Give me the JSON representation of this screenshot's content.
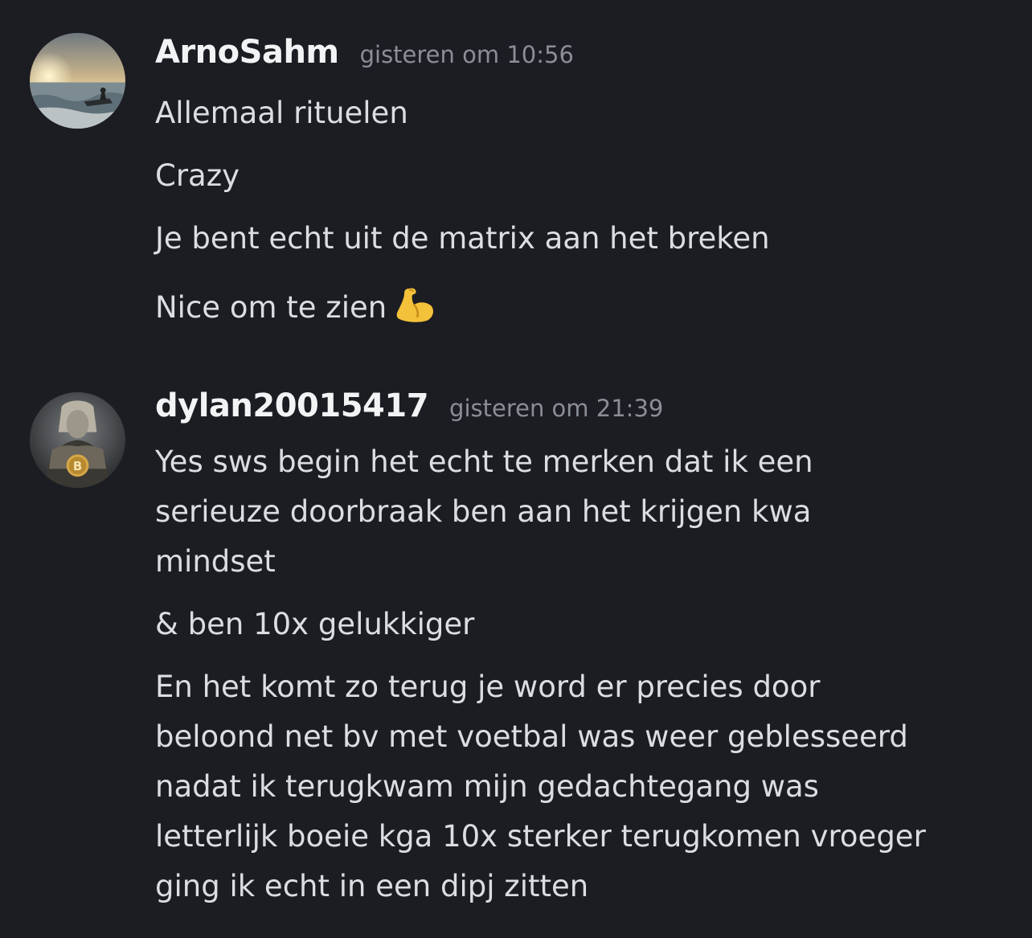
{
  "messages": [
    {
      "username": "ArnoSahm",
      "timestamp": "gisteren om 10:56",
      "avatar_icon": "seascape-jetski-avatar",
      "lines": [
        "Allemaal rituelen",
        "Crazy",
        "Je bent echt uit de matrix aan het breken",
        "Nice om te zien"
      ],
      "emoji": "flexed-biceps-icon"
    },
    {
      "username": "dylan20015417",
      "timestamp": "gisteren om 21:39",
      "avatar_icon": "armored-figure-bitcoin-avatar",
      "paragraphs": [
        [
          "Yes sws begin het echt te merken dat ik een",
          "serieuze doorbraak ben aan het krijgen kwa",
          "mindset"
        ],
        [
          "& ben 10x gelukkiger"
        ],
        [
          "En het komt zo terug je word er precies door",
          "beloond net bv met voetbal was weer geblesseerd",
          "nadat ik terugkwam mijn gedachtegang was",
          "letterlijk boeie kga 10x sterker terugkomen vroeger",
          "ging ik echt in een dipj zitten"
        ]
      ]
    }
  ]
}
